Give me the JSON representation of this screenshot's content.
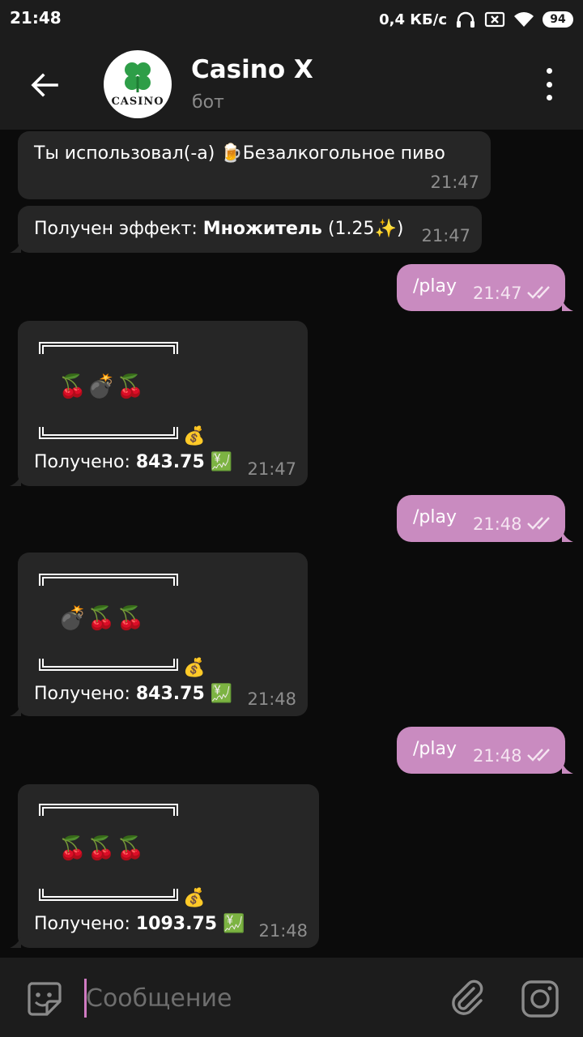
{
  "status_bar": {
    "time": "21:48",
    "network_speed": "0,4 КБ/с",
    "battery": "94",
    "icons": [
      "headphones-icon",
      "sim-off-icon",
      "wifi-icon",
      "battery-icon"
    ]
  },
  "header": {
    "title": "Casino X",
    "subtitle": "бот",
    "avatar_text": "CASINO",
    "icons": [
      "back-arrow-icon",
      "more-vertical-icon"
    ]
  },
  "messages": [
    {
      "direction": "in",
      "text_plain": "Ты использовал(-а) 🍺Безалкогольное пиво",
      "time": "21:47"
    },
    {
      "direction": "in",
      "text_prefix": "Получен эффект: ",
      "text_bold": "Множитель",
      "text_suffix": " (1.25✨)",
      "time": "21:47"
    },
    {
      "direction": "out",
      "text": "/play",
      "time": "21:47"
    },
    {
      "direction": "in",
      "slots": "🍒💣🍒",
      "bag": "💰",
      "label": "Получено: ",
      "amount": "843.75",
      "trend": "💹",
      "time": "21:47"
    },
    {
      "direction": "out",
      "text": "/play",
      "time": "21:48"
    },
    {
      "direction": "in",
      "slots": "💣🍒🍒",
      "bag": "💰",
      "label": "Получено: ",
      "amount": "843.75",
      "trend": "💹",
      "time": "21:48"
    },
    {
      "direction": "out",
      "text": "/play",
      "time": "21:48"
    },
    {
      "direction": "in",
      "slots": "🍒🍒🍒",
      "bag": "💰",
      "label": "Получено: ",
      "amount": "1093.75",
      "trend": "💹",
      "time": "21:48"
    }
  ],
  "composer": {
    "placeholder": "Сообщение",
    "icons": [
      "sticker-icon",
      "paperclip-icon",
      "camera-icon"
    ]
  },
  "colors": {
    "background": "#0b0b0b",
    "bar": "#1c1c1c",
    "incoming_bubble": "#262626",
    "outgoing_bubble": "#c98bc0",
    "caret": "#d07bc2"
  }
}
